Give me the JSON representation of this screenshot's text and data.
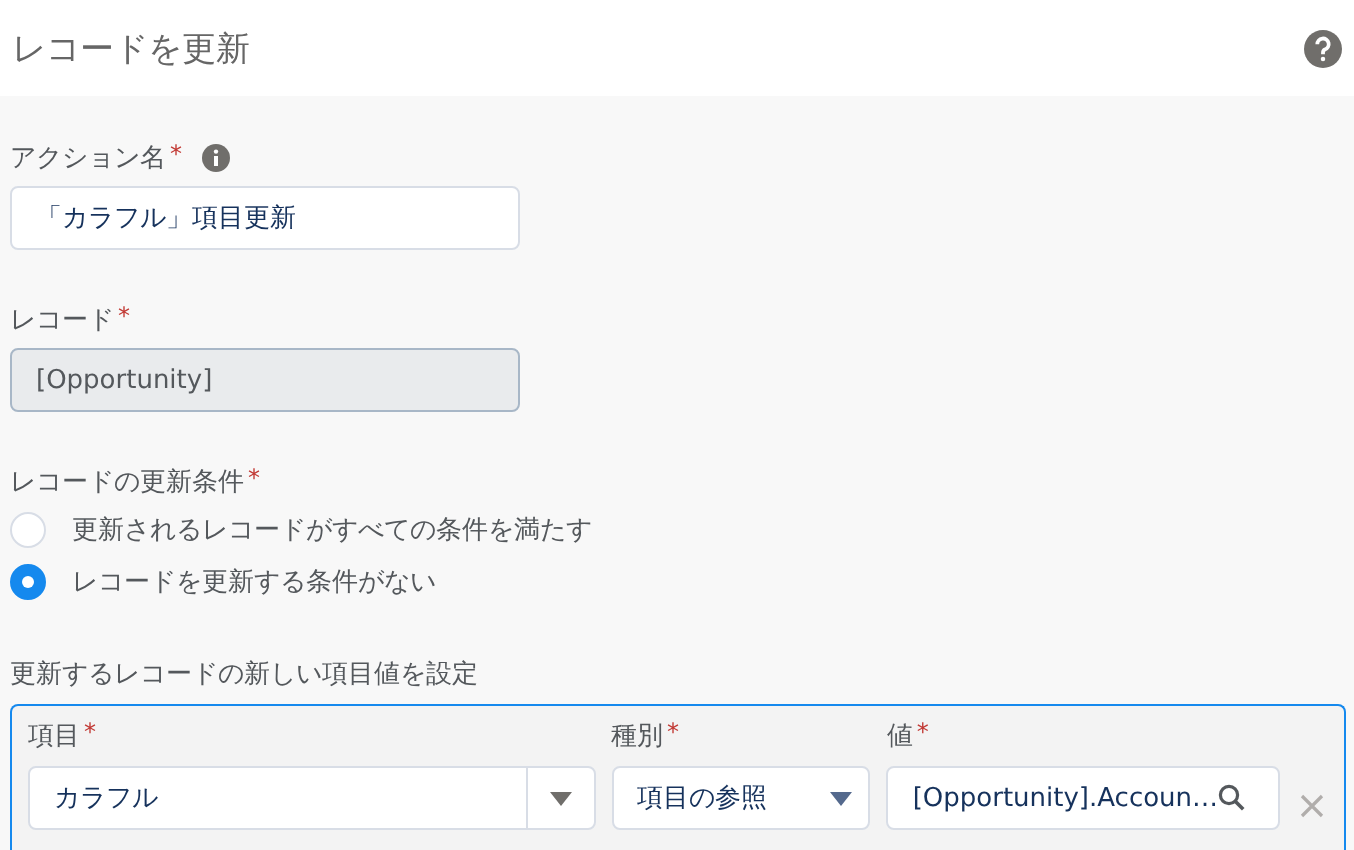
{
  "header": {
    "title": "レコードを更新"
  },
  "action_name": {
    "label": "アクション名",
    "required_mark": "*",
    "value": "「カラフル」項目更新"
  },
  "record": {
    "label": "レコード",
    "required_mark": "*",
    "value": "[Opportunity]",
    "disabled": true
  },
  "update_condition": {
    "label": "レコードの更新条件",
    "required_mark": "*",
    "options": [
      {
        "label": "更新されるレコードがすべての条件を満たす",
        "selected": false
      },
      {
        "label": "レコードを更新する条件がない",
        "selected": true
      }
    ]
  },
  "field_values": {
    "label": "更新するレコードの新しい項目値を設定",
    "columns": [
      {
        "label": "項目",
        "required_mark": "*",
        "kind": "combobox",
        "value": "カラフル"
      },
      {
        "label": "種別",
        "required_mark": "*",
        "kind": "select",
        "value": "項目の参照"
      },
      {
        "label": "値",
        "required_mark": "*",
        "kind": "lookup",
        "value": "[Opportunity].Accoun…"
      }
    ]
  }
}
